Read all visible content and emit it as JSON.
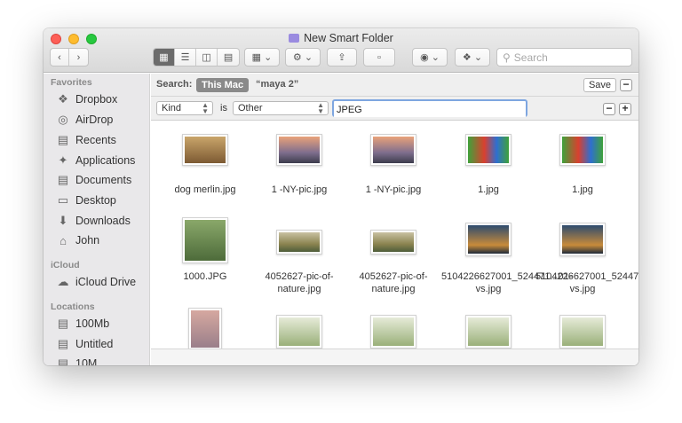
{
  "window": {
    "title": "New Smart Folder"
  },
  "toolbar": {
    "back_icon": "chevron-left-icon",
    "forward_icon": "chevron-right-icon",
    "view_modes": [
      "icon-view",
      "list-view",
      "column-view",
      "gallery-view"
    ],
    "search_placeholder": "Search"
  },
  "sidebar": {
    "favorites_header": "Favorites",
    "favorites": [
      {
        "label": "Dropbox",
        "icon": "dropbox-icon"
      },
      {
        "label": "AirDrop",
        "icon": "airdrop-icon"
      },
      {
        "label": "Recents",
        "icon": "recents-icon"
      },
      {
        "label": "Applications",
        "icon": "applications-icon"
      },
      {
        "label": "Documents",
        "icon": "documents-icon"
      },
      {
        "label": "Desktop",
        "icon": "desktop-icon"
      },
      {
        "label": "Downloads",
        "icon": "downloads-icon"
      },
      {
        "label": "John",
        "icon": "home-icon"
      }
    ],
    "icloud_header": "iCloud",
    "icloud": [
      {
        "label": "iCloud Drive",
        "icon": "cloud-icon"
      }
    ],
    "locations_header": "Locations",
    "locations": [
      {
        "label": "100Mb",
        "icon": "disk-icon"
      },
      {
        "label": "Untitled",
        "icon": "disk-icon"
      },
      {
        "label": "10M",
        "icon": "disk-icon"
      }
    ]
  },
  "searchbar": {
    "search_label": "Search:",
    "scope_selected": "This Mac",
    "scope_other": "“maya 2”",
    "save_label": "Save",
    "minus": "−"
  },
  "criteria": {
    "attribute": "Kind",
    "is_label": "is",
    "operator": "Other",
    "value": "JPEG",
    "minus": "−",
    "plus": "+"
  },
  "files": [
    {
      "name": "dog merlin.jpg",
      "color": "#9a7b4a"
    },
    {
      "name": "1 -NY-pic.jpg",
      "color": "#c8735a"
    },
    {
      "name": "1 -NY-pic.jpg",
      "color": "#c8735a"
    },
    {
      "name": "1.jpg",
      "color": "#3d9b2e"
    },
    {
      "name": "1.jpg",
      "color": "#3d9b2e"
    },
    {
      "name": "1000.JPG",
      "color": "#6b8a52"
    },
    {
      "name": "4052627-pic-of-nature.jpg",
      "color": "#9a9a6a"
    },
    {
      "name": "4052627-pic-of-nature.jpg",
      "color": "#9a9a6a"
    },
    {
      "name": "5104226627001_524471...01-vs.jpg",
      "color": "#2f4f6e"
    },
    {
      "name": "5104226627001_524471...01-vs.jpg",
      "color": "#2f4f6e"
    },
    {
      "name": "",
      "color": "#c79a8a"
    },
    {
      "name": "",
      "color": "#b9c2a4"
    },
    {
      "name": "",
      "color": "#b9c2a4"
    },
    {
      "name": "",
      "color": "#b9c2a4"
    },
    {
      "name": "",
      "color": "#b9c2a4"
    }
  ]
}
